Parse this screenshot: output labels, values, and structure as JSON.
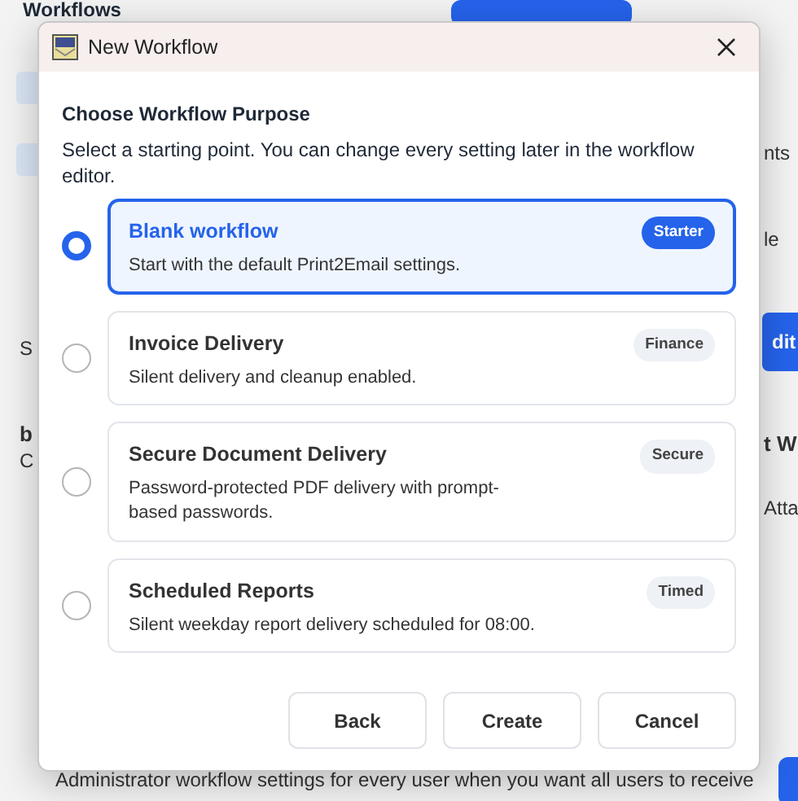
{
  "background": {
    "title": "Workflows",
    "fragments": [
      {
        "kind": "text",
        "text": "nts"
      },
      {
        "kind": "text",
        "text": "le"
      },
      {
        "kind": "text",
        "text": "S"
      },
      {
        "kind": "button",
        "text": "dit"
      },
      {
        "kind": "heading",
        "text": "b"
      },
      {
        "kind": "text",
        "text": "C"
      },
      {
        "kind": "heading",
        "text": "t W"
      },
      {
        "kind": "text",
        "text": "Atta"
      },
      {
        "kind": "text",
        "text": "Administrator workflow settings for every user when you want all users to receive"
      }
    ]
  },
  "dialog": {
    "title": "New Workflow",
    "heading": "Choose Workflow Purpose",
    "intro": "Select a starting point. You can change every setting later in the workflow editor.",
    "options": [
      {
        "title": "Blank workflow",
        "description": "Start with the default Print2Email settings.",
        "tag": "Starter",
        "selected": true
      },
      {
        "title": "Invoice Delivery",
        "description": "Silent delivery and cleanup enabled.",
        "tag": "Finance",
        "selected": false
      },
      {
        "title": "Secure Document Delivery",
        "description": "Password-protected PDF delivery with prompt-based passwords.",
        "tag": "Secure",
        "selected": false
      },
      {
        "title": "Scheduled Reports",
        "description": "Silent weekday report delivery scheduled for 08:00.",
        "tag": "Timed",
        "selected": false
      }
    ],
    "buttons": [
      "Back",
      "Create",
      "Cancel"
    ]
  }
}
